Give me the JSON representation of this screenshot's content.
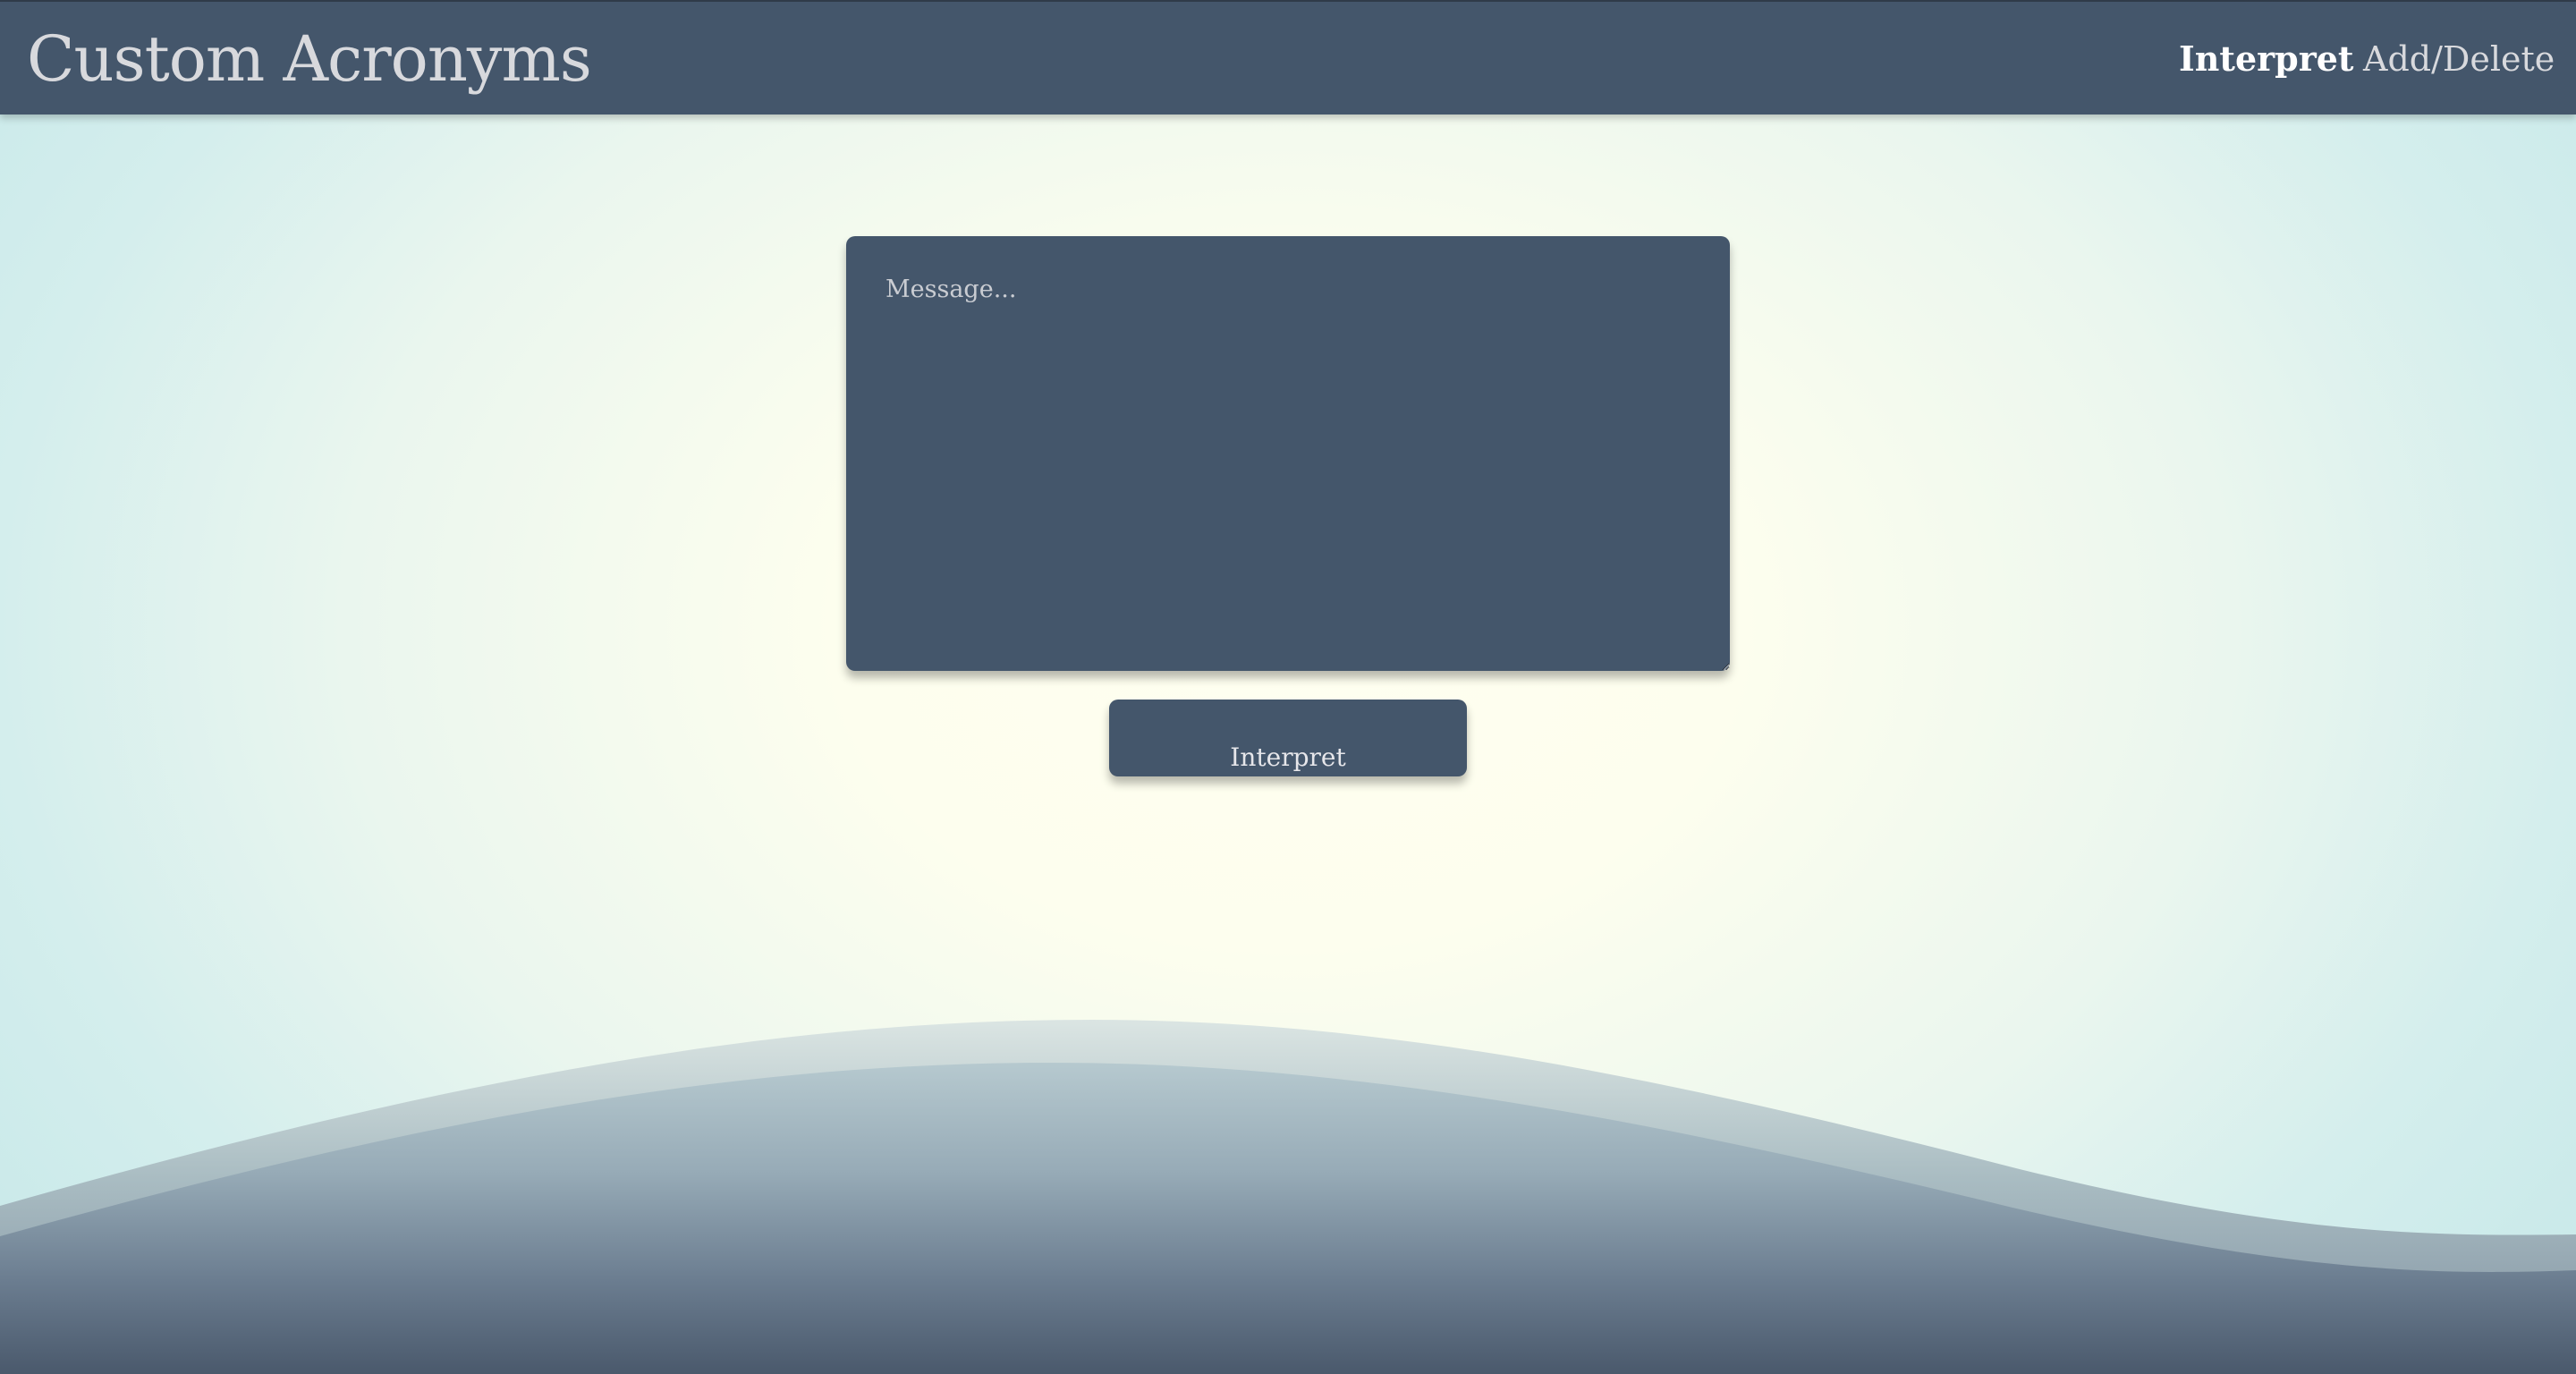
{
  "header": {
    "title": "Custom Acronyms",
    "nav": [
      {
        "label": "Interpret",
        "active": true
      },
      {
        "label": "Add/Delete",
        "active": false
      }
    ]
  },
  "main": {
    "message_input": {
      "placeholder": "Message...",
      "value": ""
    },
    "submit_label": "Interpret"
  },
  "colors": {
    "header_background": "#44566b",
    "panel_background": "#44566b",
    "page_background_center": "#fffff0",
    "page_background_edge": "#cbeaea",
    "wave_light": "#c4d6d8",
    "wave_dark": "#4d5d71"
  }
}
